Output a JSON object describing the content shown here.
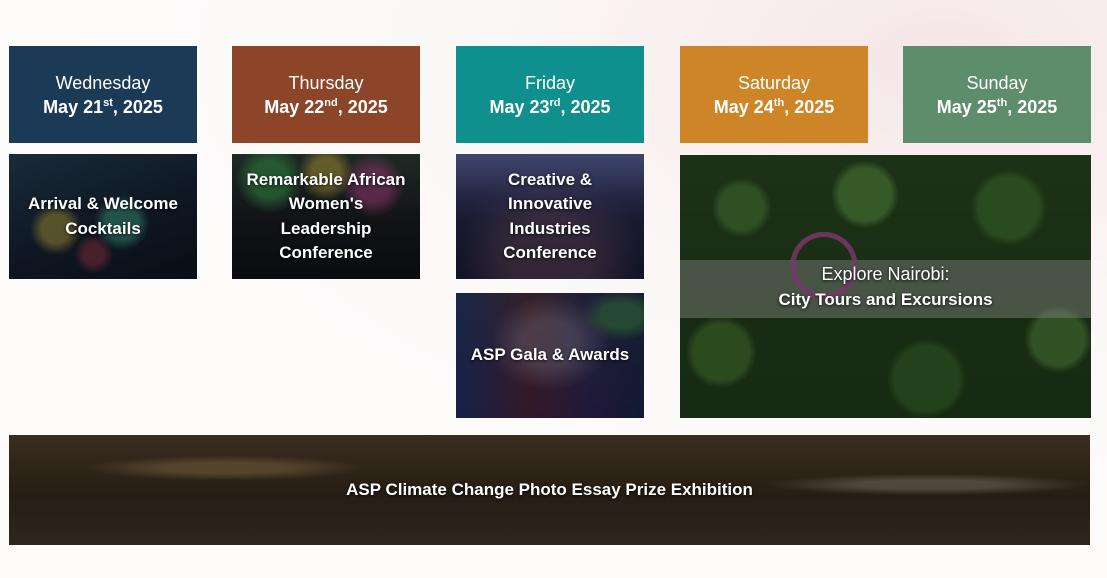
{
  "days": [
    {
      "name": "Wednesday",
      "date_prefix": "May 21",
      "suffix": "st",
      "year": ", 2025",
      "color": "#1b3a55"
    },
    {
      "name": "Thursday",
      "date_prefix": "May 22",
      "suffix": "nd",
      "year": ", 2025",
      "color": "#8d452a"
    },
    {
      "name": "Friday",
      "date_prefix": "May 23",
      "suffix": "rd",
      "year": ", 2025",
      "color": "#0f8f8d"
    },
    {
      "name": "Saturday",
      "date_prefix": "May 24",
      "suffix": "th",
      "year": ", 2025",
      "color": "#cd8527"
    },
    {
      "name": "Sunday",
      "date_prefix": "May 25",
      "suffix": "th",
      "year": ", 2025",
      "color": "#5e8d6c"
    }
  ],
  "events": {
    "arrival": {
      "line1": "Arrival & Welcome",
      "line2": "Cocktails"
    },
    "womens": {
      "line1": "Remarkable African",
      "line2": "Women's",
      "line3": "Leadership",
      "line4": "Conference"
    },
    "creative": {
      "line1": "Creative &",
      "line2": "Innovative",
      "line3": "Industries",
      "line4": "Conference"
    },
    "gala": {
      "line1": "ASP Gala & Awards"
    },
    "nairobi": {
      "line1": "Explore Nairobi:",
      "line2": "City Tours and Excursions"
    },
    "exhibition": {
      "line1": "ASP Climate Change Photo Essay Prize Exhibition"
    }
  }
}
